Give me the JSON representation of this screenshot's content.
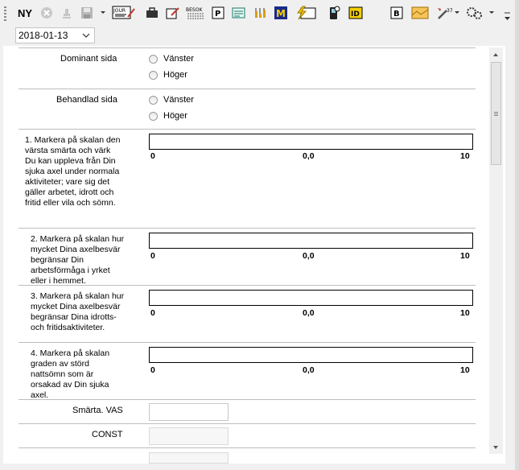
{
  "toolbar": {
    "new_label": "NY",
    "icons": [
      "cancel-icon",
      "stamp-icon",
      "save-icon",
      "journal-icon",
      "briefcase-icon",
      "edit-icon",
      "visit-icon",
      "prescription-icon",
      "document-icon",
      "lab-icon",
      "referral-icon",
      "flash-icon",
      "phone-icon",
      "id-icon",
      "certificate-icon",
      "image-icon",
      "tools-icon",
      "settings-icon"
    ],
    "journal_text": "JOUR",
    "visit_text": "BESOK",
    "prescription_text": "P",
    "referral_text": "M",
    "id_text": "ID",
    "certificate_text": "B",
    "tools_badge": "37"
  },
  "date_select": {
    "value": "2018-01-13"
  },
  "form": {
    "dominant_side": {
      "label": "Dominant sida",
      "options": [
        "Vänster",
        "Höger"
      ]
    },
    "treated_side": {
      "label": "Behandlad sida",
      "options": [
        "Vänster",
        "Höger"
      ]
    },
    "questions": [
      {
        "text": "1. Markera på skalan den värsta smärta och värk Du kan uppleva från Din sjuka axel under normala aktiviteter; vare sig det gäller arbetet, idrott och fritid eller vila och sömn.",
        "min": "0",
        "mid": "0,0",
        "max": "10"
      },
      {
        "text": "2. Markera på skalan hur mycket Dina axelbesvär begränsar Din arbetsförmåga i yrket eller i hemmet.",
        "min": "0",
        "mid": "0,0",
        "max": "10"
      },
      {
        "text": "3. Markera på skalan hur mycket Dina axelbesvär begränsar Dina idrotts- och fritidsaktiviteter.",
        "min": "0",
        "mid": "0,0",
        "max": "10"
      },
      {
        "text": "4. Markera på skalan graden av störd nattsömn som är orsakad av Din sjuka axel.",
        "min": "0",
        "mid": "0,0",
        "max": "10"
      }
    ],
    "pain_vas": {
      "label": "Smärta. VAS",
      "value": ""
    },
    "const": {
      "label": "CONST",
      "value": ""
    }
  }
}
